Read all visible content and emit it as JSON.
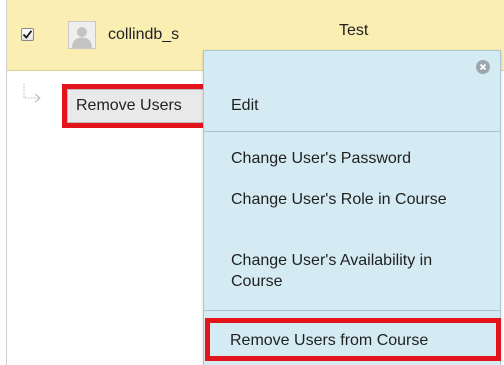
{
  "user_row": {
    "username": "collindb_s",
    "value": "Test",
    "checkbox_checked": true,
    "avatar_icon": "user-avatar-icon"
  },
  "table": {
    "remove_users_button": "Remove Users",
    "connector_icon": "arrow-connector-icon"
  },
  "context_menu": {
    "close_icon": "close-icon",
    "items": [
      {
        "label": "Edit"
      },
      {
        "label": "Change User's Password"
      },
      {
        "label": "Change User's Role in Course"
      },
      {
        "label": "Change User's Availability in Course"
      },
      {
        "label": "Remove Users from Course"
      }
    ]
  },
  "colors": {
    "highlight_border": "#e4141d",
    "menu_background": "#d5ebf3",
    "row_background": "#fbeeb3"
  }
}
